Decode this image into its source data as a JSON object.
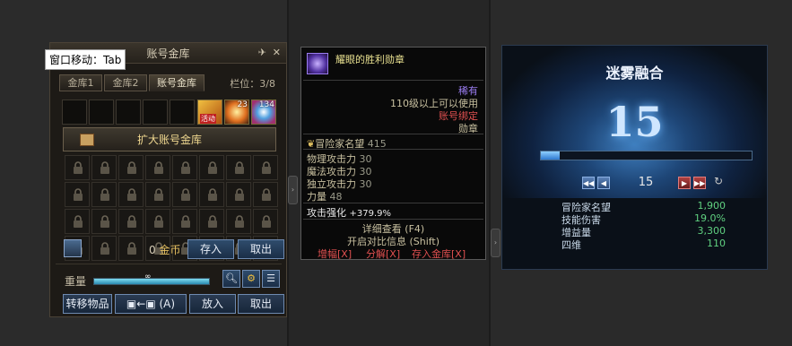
{
  "vault": {
    "tooltip_label": "窗口移动：Tab",
    "title": "账号金库",
    "pin_icon": "pin-icon",
    "close_icon": "close-icon",
    "tabs": [
      {
        "label": "金库1",
        "active": false
      },
      {
        "label": "金库2",
        "active": false
      },
      {
        "label": "账号金库",
        "active": true
      }
    ],
    "slots_label": "栏位：3/8",
    "items": [
      {
        "name": "activity-box-item",
        "badge": "活动",
        "count": ""
      },
      {
        "name": "fire-box-item",
        "count": "23"
      },
      {
        "name": "orb-item",
        "count": "134"
      }
    ],
    "expand_label": "扩大账号金库",
    "gold_amount": "0",
    "gold_unit": "金币",
    "deposit_label": "存入",
    "withdraw_label": "取出",
    "weight_label": "重量",
    "weight_value": "∞",
    "weight_fill": 1.0,
    "transfer_label": "转移物品",
    "transfer_shortcut": "(A)",
    "put_in_label": "放入",
    "take_out_label": "取出"
  },
  "tooltip": {
    "name": "耀眼的胜利勋章",
    "rarity": "稀有",
    "level_req": "110级以上可以使用",
    "bind": "账号绑定",
    "category": "勋章",
    "fame_label": "冒险家名望",
    "fame_value": "415",
    "stats": [
      {
        "label": "物理攻击力",
        "value": "30"
      },
      {
        "label": "魔法攻击力",
        "value": "30"
      },
      {
        "label": "独立攻击力",
        "value": "30"
      },
      {
        "label": "力量",
        "value": "48"
      }
    ],
    "enhance_label": "攻击强化",
    "enhance_value": "+379.9%",
    "detail": "详细查看 (F4)",
    "compare": "开启对比信息 (Shift)",
    "actions": [
      "增幅[X]",
      "分解[X]",
      "存入金库[X]"
    ],
    "colors": {
      "name": "#e8e090",
      "rarity": "#9a7cf0",
      "bind": "#e05050",
      "label": "#c8c0a0"
    }
  },
  "fusion": {
    "title": "迷雾融合",
    "level": "15",
    "progress": 0.09,
    "nav_value": "15",
    "stats": [
      {
        "label": "冒险家名望",
        "value": "1,900"
      },
      {
        "label": "技能伤害",
        "value": "19.0%"
      },
      {
        "label": "增益量",
        "value": "3,300"
      },
      {
        "label": "四维",
        "value": "110"
      }
    ]
  }
}
